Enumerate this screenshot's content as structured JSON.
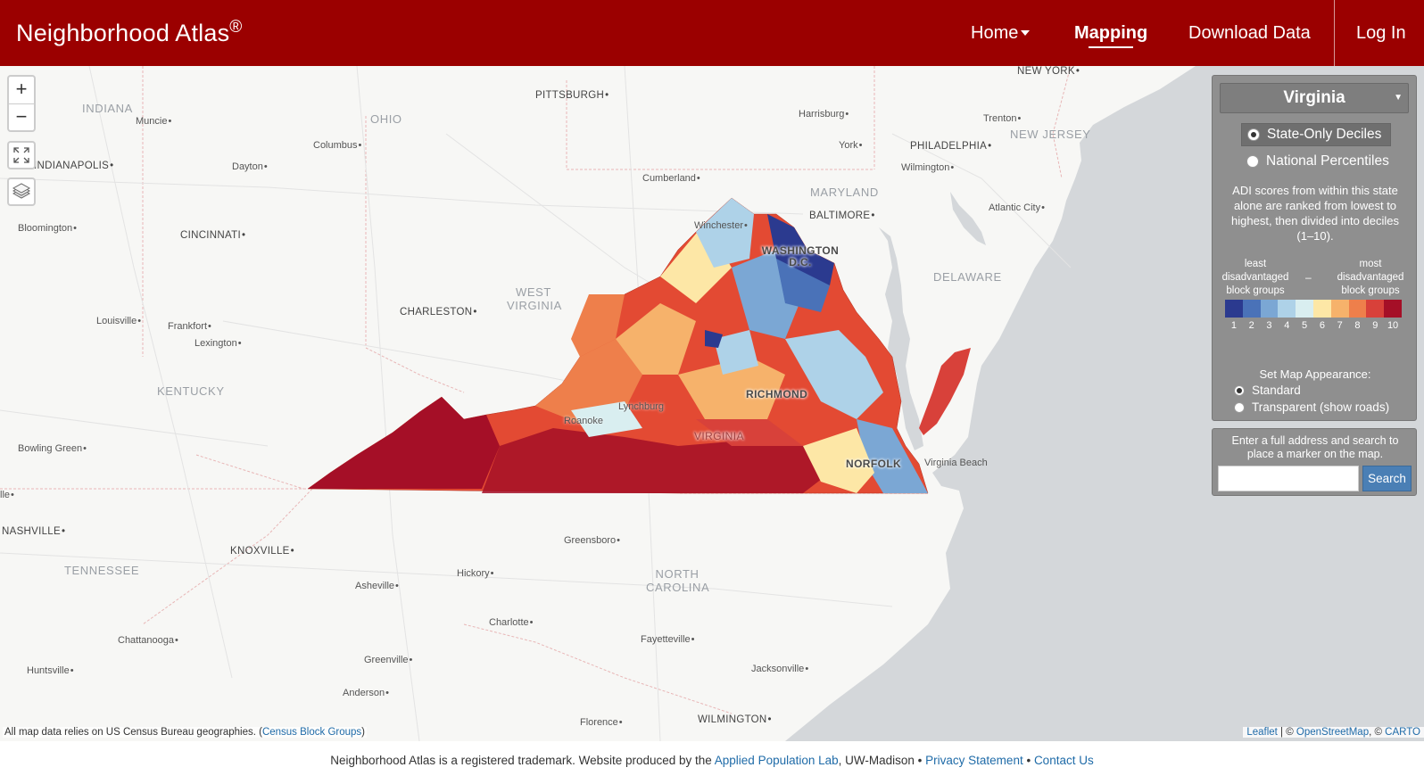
{
  "header": {
    "brand": "Neighborhood Atlas",
    "brand_mark": "®",
    "nav": {
      "home": "Home",
      "mapping": "Mapping",
      "download": "Download Data",
      "login": "Log In"
    }
  },
  "map": {
    "controls": {
      "zoom_in": "+",
      "zoom_out": "−"
    },
    "places": [
      {
        "id": "new-york",
        "label": "NEW YORK"
      },
      {
        "id": "indiana",
        "label": "INDIANA"
      },
      {
        "id": "muncie",
        "label": "Muncie"
      },
      {
        "id": "pittsburgh",
        "label": "PITTSBURGH"
      },
      {
        "id": "ohio",
        "label": "OHIO"
      },
      {
        "id": "harrisburg",
        "label": "Harrisburg"
      },
      {
        "id": "trenton",
        "label": "Trenton"
      },
      {
        "id": "columbus",
        "label": "Columbus"
      },
      {
        "id": "york",
        "label": "York"
      },
      {
        "id": "philadelphia",
        "label": "PHILADELPHIA"
      },
      {
        "id": "new-jersey",
        "label": "NEW JERSEY"
      },
      {
        "id": "indianapolis",
        "label": "INDIANAPOLIS"
      },
      {
        "id": "dayton",
        "label": "Dayton"
      },
      {
        "id": "wilmington-de",
        "label": "Wilmington"
      },
      {
        "id": "cumberland",
        "label": "Cumberland"
      },
      {
        "id": "maryland",
        "label": "MARYLAND"
      },
      {
        "id": "atlantic-city",
        "label": "Atlantic City"
      },
      {
        "id": "baltimore",
        "label": "BALTIMORE"
      },
      {
        "id": "bloomington",
        "label": "Bloomington"
      },
      {
        "id": "cincinnati",
        "label": "CINCINNATI"
      },
      {
        "id": "winchester",
        "label": "Winchester"
      },
      {
        "id": "washington-dc",
        "label": "WASHINGTON D.C."
      },
      {
        "id": "delaware",
        "label": "DELAWARE"
      },
      {
        "id": "west-virginia",
        "label": "WEST VIRGINIA"
      },
      {
        "id": "charleston",
        "label": "CHARLESTON"
      },
      {
        "id": "louisville",
        "label": "Louisville"
      },
      {
        "id": "frankfort",
        "label": "Frankfort"
      },
      {
        "id": "lexington",
        "label": "Lexington"
      },
      {
        "id": "kentucky",
        "label": "KENTUCKY"
      },
      {
        "id": "richmond",
        "label": "RICHMOND"
      },
      {
        "id": "lynchburg",
        "label": "Lynchburg"
      },
      {
        "id": "roanoke",
        "label": "Roanoke"
      },
      {
        "id": "virginia",
        "label": "VIRGINIA"
      },
      {
        "id": "bowling-green",
        "label": "Bowling Green"
      },
      {
        "id": "norfolk",
        "label": "NORFOLK"
      },
      {
        "id": "virginia-beach",
        "label": "Virginia Beach"
      },
      {
        "id": "nashville-edge",
        "label": "lle"
      },
      {
        "id": "nashville",
        "label": "NASHVILLE"
      },
      {
        "id": "greensboro",
        "label": "Greensboro"
      },
      {
        "id": "knoxville",
        "label": "KNOXVILLE"
      },
      {
        "id": "tennessee",
        "label": "TENNESSEE"
      },
      {
        "id": "north-carolina",
        "label": "NORTH CAROLINA"
      },
      {
        "id": "hickory",
        "label": "Hickory"
      },
      {
        "id": "asheville",
        "label": "Asheville"
      },
      {
        "id": "charlotte",
        "label": "Charlotte"
      },
      {
        "id": "chattanooga",
        "label": "Chattanooga"
      },
      {
        "id": "fayetteville",
        "label": "Fayetteville"
      },
      {
        "id": "greenville",
        "label": "Greenville"
      },
      {
        "id": "huntsville",
        "label": "Huntsville"
      },
      {
        "id": "jacksonville",
        "label": "Jacksonville"
      },
      {
        "id": "anderson",
        "label": "Anderson"
      },
      {
        "id": "florence",
        "label": "Florence"
      },
      {
        "id": "wilmington-nc",
        "label": "WILMINGTON"
      }
    ],
    "attribution_left_prefix": "All map data relies on US Census Bureau geographies. (",
    "attribution_left_link": "Census Block Groups",
    "attribution_left_suffix": ")",
    "attribution_right": {
      "leaflet": "Leaflet",
      "sep1": " | © ",
      "osm": "OpenStreetMap",
      "sep2": ", © ",
      "carto": "CARTO"
    }
  },
  "panel": {
    "state": "Virginia",
    "options": [
      "State-Only Deciles",
      "National Percentiles"
    ],
    "selected_option": "State-Only Deciles",
    "description": "ADI scores from within this state alone are ranked from lowest to highest, then divided into deciles (1–10).",
    "legend_left": "least disadvantaged block groups",
    "legend_dash": "–",
    "legend_right": "most disadvantaged block groups",
    "legend_colors": [
      "#2b3a8f",
      "#4a72b8",
      "#7ba7d4",
      "#aed2e8",
      "#d9eef0",
      "#fde7a6",
      "#f6b26b",
      "#ee7f4b",
      "#d8413a",
      "#a50f27"
    ],
    "legend_values": [
      "1",
      "2",
      "3",
      "4",
      "5",
      "6",
      "7",
      "8",
      "9",
      "10"
    ],
    "appearance_title": "Set Map Appearance:",
    "appearance_options": [
      "Standard",
      "Transparent (show roads)"
    ],
    "appearance_selected": "Standard"
  },
  "search": {
    "instructions": "Enter a full address and search to place a marker on the map.",
    "input_value": "",
    "button": "Search"
  },
  "footer": {
    "text_before": "Neighborhood Atlas is a registered trademark. Website produced by the ",
    "link_apl": "Applied Population Lab",
    "text_mid": ", UW-Madison • ",
    "link_privacy": "Privacy Statement",
    "sep": " • ",
    "link_contact": "Contact Us"
  }
}
